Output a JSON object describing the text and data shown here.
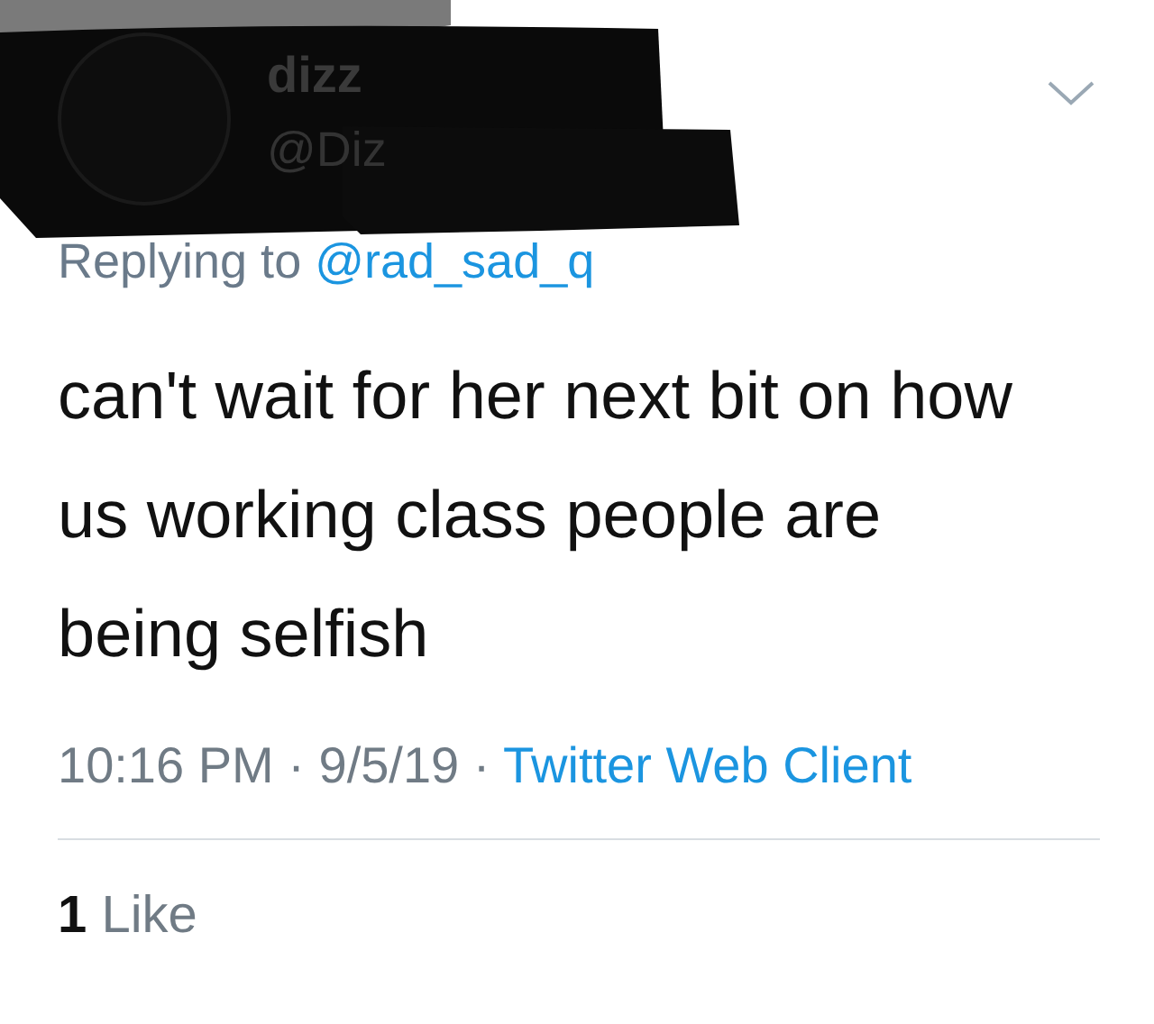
{
  "author": {
    "name": "dizz",
    "handle": "@Diz"
  },
  "reply": {
    "prefix": "Replying to",
    "handle": "@rad_sad_q"
  },
  "text": "can't wait for her next bit on how us working class people are being selfish",
  "meta": {
    "time": "10:16 PM",
    "separator": "·",
    "date": "9/5/19",
    "source": "Twitter Web Client"
  },
  "likes": {
    "count": "1",
    "label": "Like"
  }
}
